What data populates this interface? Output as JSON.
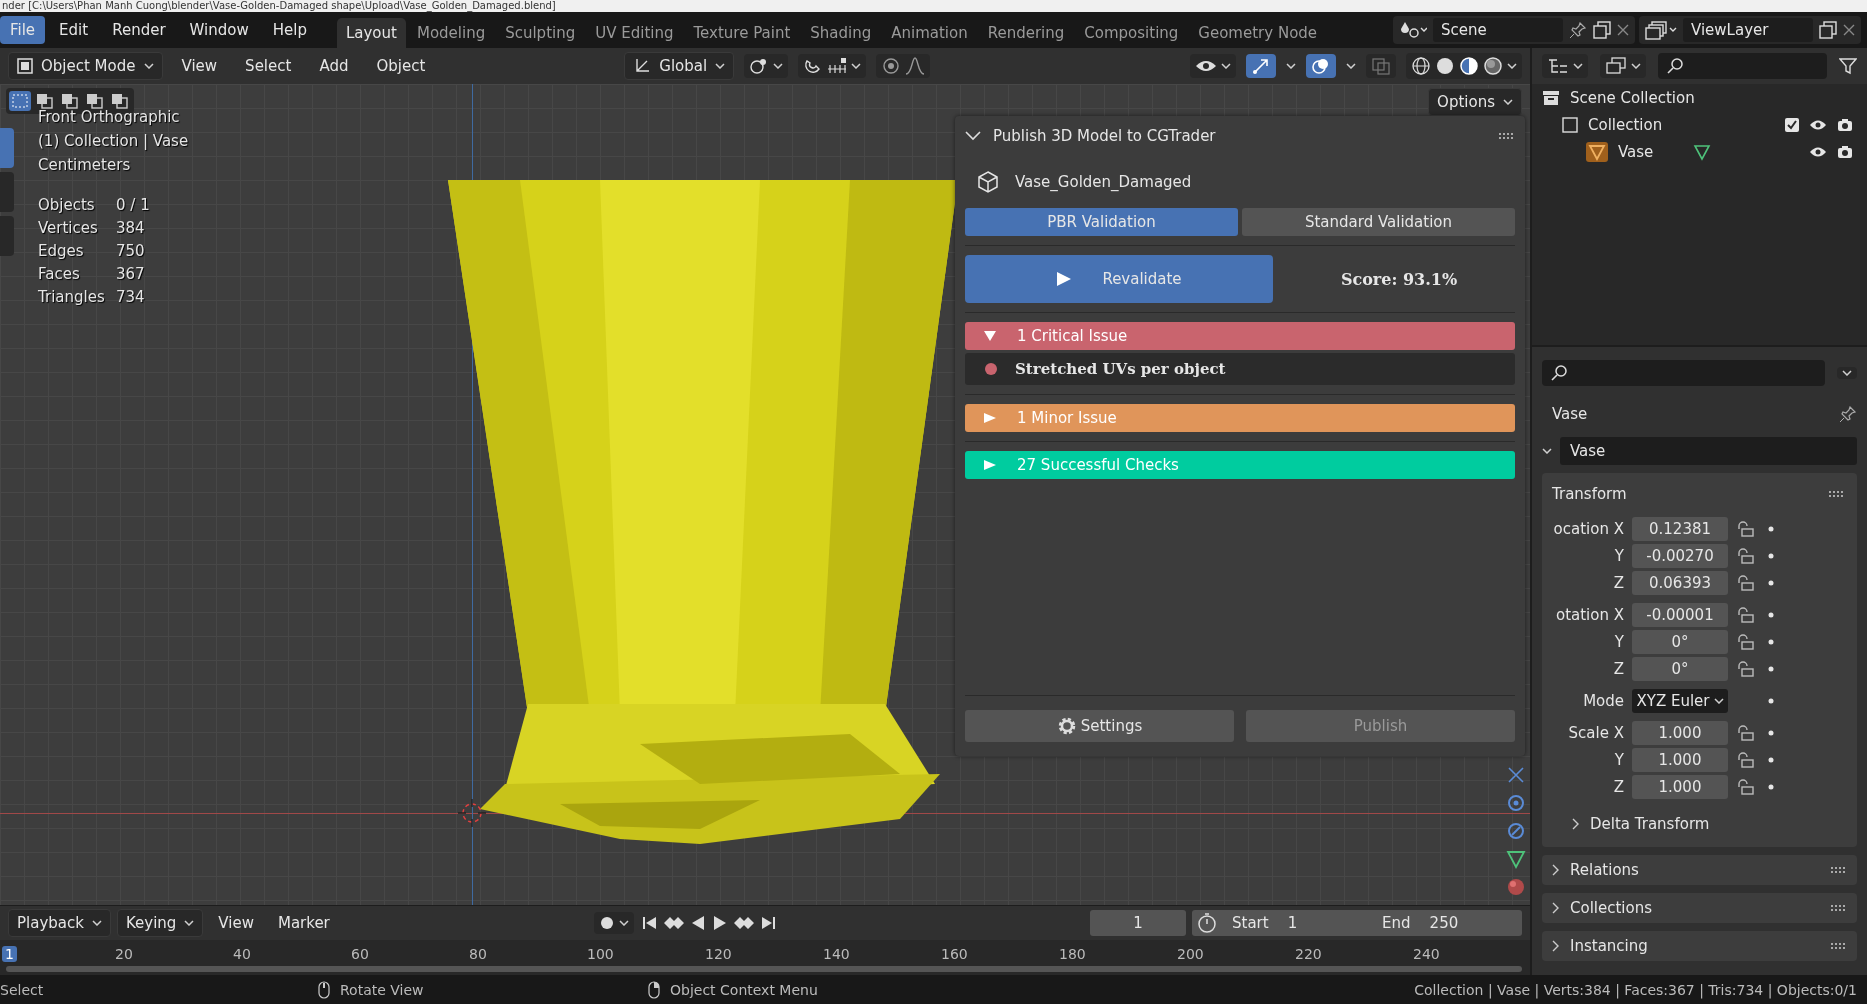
{
  "title_bar": {
    "title": "nder [C:\\Users\\Phan Manh Cuong\\blender\\Vase-Golden-Damaged shape\\Upload\\Vase_Golden_Damaged.blend]"
  },
  "menu": [
    {
      "label": "File",
      "selected": true
    },
    {
      "label": "Edit",
      "selected": false
    },
    {
      "label": "Render",
      "selected": false
    },
    {
      "label": "Window",
      "selected": false
    },
    {
      "label": "Help",
      "selected": false
    }
  ],
  "workspaces": [
    {
      "label": "Layout",
      "selected": true
    },
    {
      "label": "Modeling",
      "selected": false
    },
    {
      "label": "Sculpting",
      "selected": false
    },
    {
      "label": "UV Editing",
      "selected": false
    },
    {
      "label": "Texture Paint",
      "selected": false
    },
    {
      "label": "Shading",
      "selected": false
    },
    {
      "label": "Animation",
      "selected": false
    },
    {
      "label": "Rendering",
      "selected": false
    },
    {
      "label": "Compositing",
      "selected": false
    },
    {
      "label": "Geometry Node",
      "selected": false
    }
  ],
  "scene": {
    "name": "Scene"
  },
  "view_layer": {
    "name": "ViewLayer"
  },
  "header": {
    "mode": "Object Mode",
    "menus": [
      "View",
      "Select",
      "Add",
      "Object"
    ],
    "orientation": "Global",
    "options": "Options"
  },
  "viewport": {
    "overlay": [
      "Front Orthographic",
      "(1) Collection | Vase",
      "Centimeters"
    ],
    "stats": [
      {
        "label": "Objects",
        "value": "0 / 1"
      },
      {
        "label": "Vertices",
        "value": "384"
      },
      {
        "label": "Edges",
        "value": "750"
      },
      {
        "label": "Faces",
        "value": "367"
      },
      {
        "label": "Triangles",
        "value": "734"
      }
    ]
  },
  "addon_panel": {
    "title": "Publish 3D Model to CGTrader",
    "model": "Vase_Golden_Damaged",
    "tabs": [
      {
        "label": "PBR Validation",
        "selected": true
      },
      {
        "label": "Standard Validation",
        "selected": false
      }
    ],
    "revalidate": "Revalidate",
    "score": "Score: 93.1%",
    "groups": [
      {
        "label": "1 Critical Issue",
        "color": "#c9646e",
        "expanded": true,
        "items": [
          {
            "label": "Stretched UVs per object",
            "color": "#c9646e"
          }
        ]
      },
      {
        "label": "1 Minor Issue",
        "color": "#e0955a",
        "expanded": false
      },
      {
        "label": "27 Successful Checks",
        "color": "#00cc9f",
        "expanded": false
      }
    ],
    "buttons": [
      {
        "label": "Settings",
        "kind": "settings",
        "disabled": false
      },
      {
        "label": "Publish",
        "kind": "plain",
        "disabled": true
      }
    ]
  },
  "timeline": {
    "menus": [
      {
        "label": "Playback",
        "dropdown": true
      },
      {
        "label": "Keying",
        "dropdown": true
      },
      {
        "label": "View",
        "dropdown": false
      },
      {
        "label": "Marker",
        "dropdown": false
      }
    ],
    "current_frame": "1",
    "start_label": "Start",
    "start": "1",
    "end_label": "End",
    "end": "250",
    "ticks": [
      {
        "label": "1",
        "selected": true
      },
      {
        "label": "20",
        "selected": false
      },
      {
        "label": "40",
        "selected": false
      },
      {
        "label": "60",
        "selected": false
      },
      {
        "label": "80",
        "selected": false
      },
      {
        "label": "100",
        "selected": false
      },
      {
        "label": "120",
        "selected": false
      },
      {
        "label": "140",
        "selected": false
      },
      {
        "label": "160",
        "selected": false
      },
      {
        "label": "180",
        "selected": false
      },
      {
        "label": "200",
        "selected": false
      },
      {
        "label": "220",
        "selected": false
      },
      {
        "label": "240",
        "selected": false
      }
    ]
  },
  "outliner": {
    "scene_collection": "Scene Collection",
    "items": [
      {
        "name": "Collection",
        "kind": "collection",
        "checked": true
      },
      {
        "name": "Vase",
        "kind": "mesh"
      }
    ]
  },
  "properties": {
    "object_name": "Vase",
    "data_name": "Vase",
    "panel": "Transform",
    "groups": [
      {
        "rows": [
          {
            "label": "ocation X",
            "value": "0.12381",
            "kind": "number"
          },
          {
            "label": "Y",
            "value": "-0.00270",
            "kind": "number"
          },
          {
            "label": "Z",
            "value": "0.06393",
            "kind": "number"
          }
        ]
      },
      {
        "rows": [
          {
            "label": "otation X",
            "value": "-0.00001",
            "kind": "number"
          },
          {
            "label": "Y",
            "value": "0°",
            "kind": "number"
          },
          {
            "label": "Z",
            "value": "0°",
            "kind": "number"
          }
        ]
      },
      {
        "rows": [
          {
            "label": "Mode",
            "value": "XYZ Euler",
            "kind": "dropdown"
          }
        ]
      },
      {
        "rows": [
          {
            "label": "Scale X",
            "value": "1.000",
            "kind": "number"
          },
          {
            "label": "Y",
            "value": "1.000",
            "kind": "number"
          },
          {
            "label": "Z",
            "value": "1.000",
            "kind": "number"
          }
        ]
      }
    ],
    "subpanels": [
      "Delta Transform"
    ],
    "sections": [
      "Relations",
      "Collections",
      "Instancing"
    ]
  },
  "status_bar": {
    "hints": [
      {
        "label": "Select",
        "kind": "left"
      },
      {
        "label": "Rotate View",
        "kind": "middle"
      },
      {
        "label": "Object Context Menu",
        "kind": "right"
      }
    ],
    "stats": "Collection | Vase | Verts:384 | Faces:367 | Tris:734 | Objects:0/1"
  }
}
